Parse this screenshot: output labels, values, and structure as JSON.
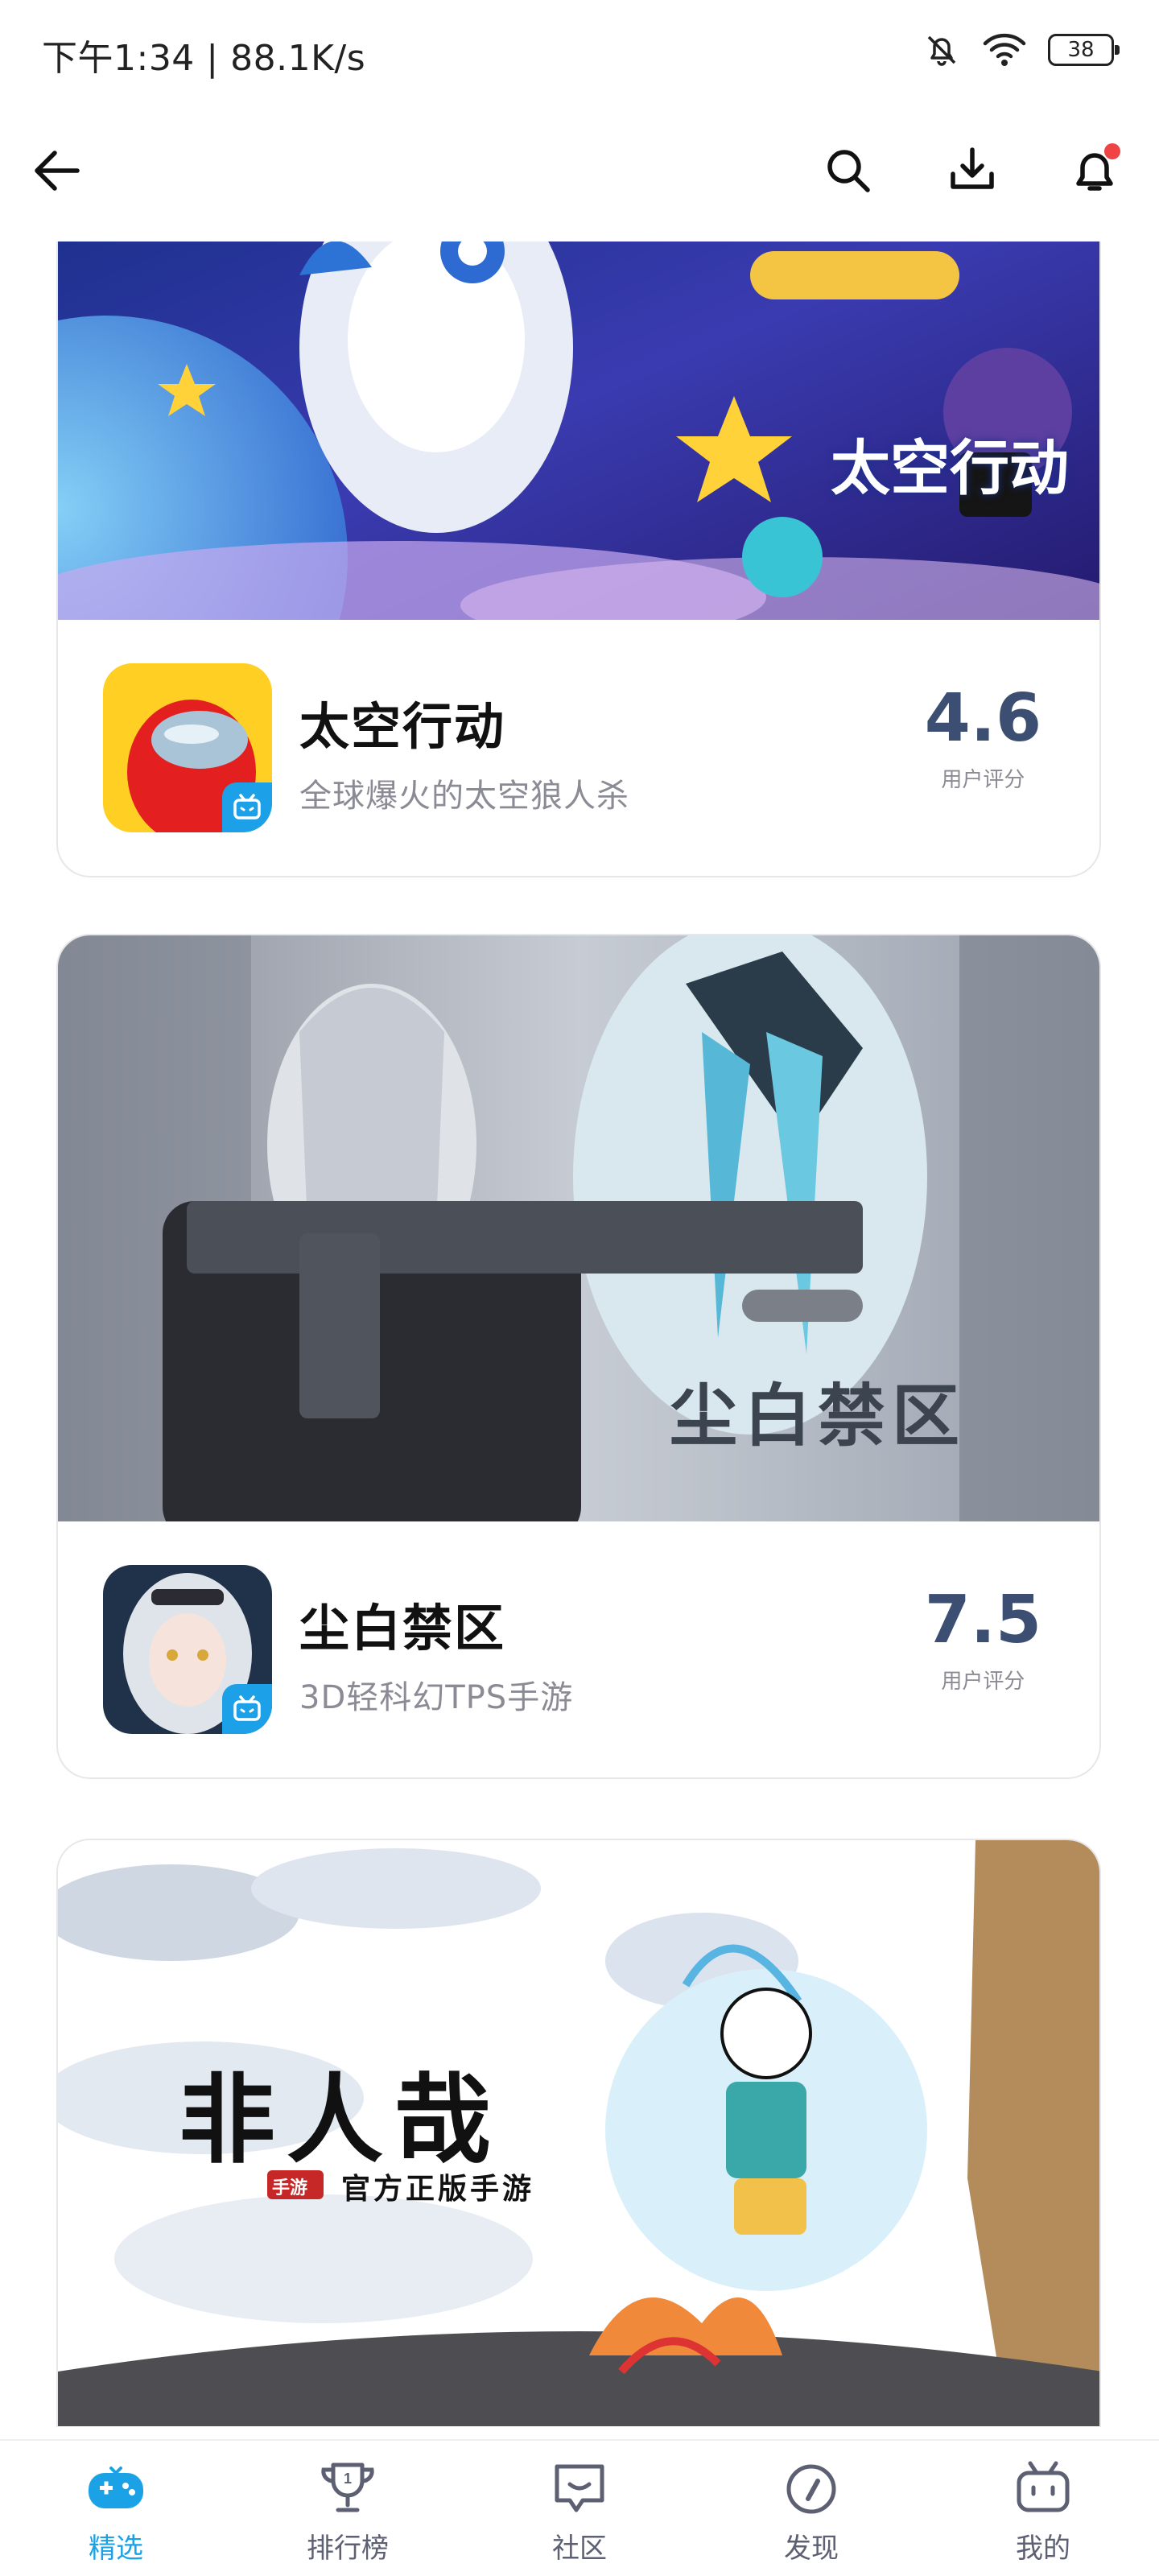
{
  "status_bar": {
    "left_text": "下午1:34 | 88.1K/s",
    "battery": "38"
  },
  "games": [
    {
      "banner_title": "太空行动",
      "name": "太空行动",
      "subtitle": "全球爆火的太空狼人杀",
      "rating": "4.6",
      "rating_label": "用户评分"
    },
    {
      "banner_title": "尘白禁区",
      "name": "尘白禁区",
      "subtitle": "3D轻科幻TPS手游",
      "rating": "7.5",
      "rating_label": "用户评分"
    },
    {
      "banner_title": "非人哉",
      "banner_tag": "手游",
      "banner_slogan": "官方正版手游"
    }
  ],
  "tabs": [
    {
      "label": "精选",
      "icon": "gamepad-icon",
      "active": true
    },
    {
      "label": "排行榜",
      "icon": "trophy-icon",
      "active": false
    },
    {
      "label": "社区",
      "icon": "chat-icon",
      "active": false
    },
    {
      "label": "发现",
      "icon": "compass-icon",
      "active": false
    },
    {
      "label": "我的",
      "icon": "tv-face-icon",
      "active": false
    }
  ],
  "colors": {
    "accent": "#1ba2e6",
    "rating": "#3c4f72",
    "notification": "#f04343"
  }
}
